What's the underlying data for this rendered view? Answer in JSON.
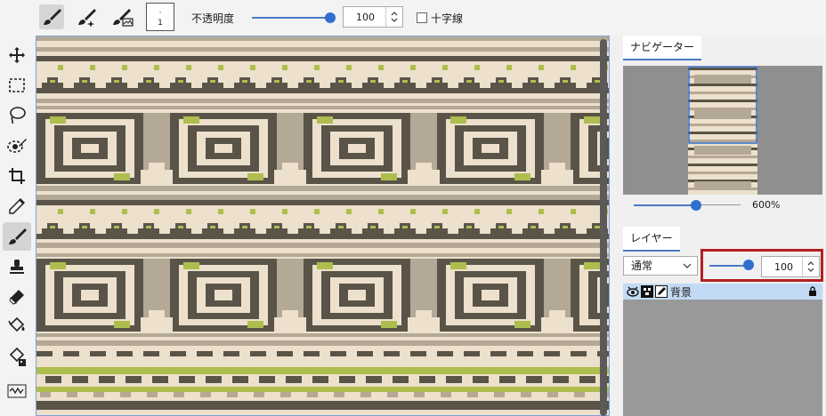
{
  "toolbar": {
    "brush_size_value": "1",
    "opacity_label": "不透明度",
    "opacity_value": "100",
    "crosshair_label": "十字線"
  },
  "tools": [
    "move-tool",
    "rect-select-tool",
    "lasso-tool",
    "eye-select-tool",
    "crop-tool",
    "eyedropper-tool",
    "brush-tool",
    "stamp-tool",
    "eraser-tool",
    "fill-tool",
    "gradient-fill-tool",
    "wave-tool"
  ],
  "navigator": {
    "tab_label": "ナビゲーター",
    "zoom_value": "600%"
  },
  "layers": {
    "tab_label": "レイヤー",
    "blend_mode": "通常",
    "opacity_value": "100",
    "items": [
      {
        "name": "背景"
      }
    ]
  },
  "colors": {
    "dark": "#5a5448",
    "cream": "#ede0cc",
    "taupe": "#b4a896",
    "green": "#aebe4e",
    "accent": "#2f6fd0",
    "highlight": "#b3201f"
  }
}
